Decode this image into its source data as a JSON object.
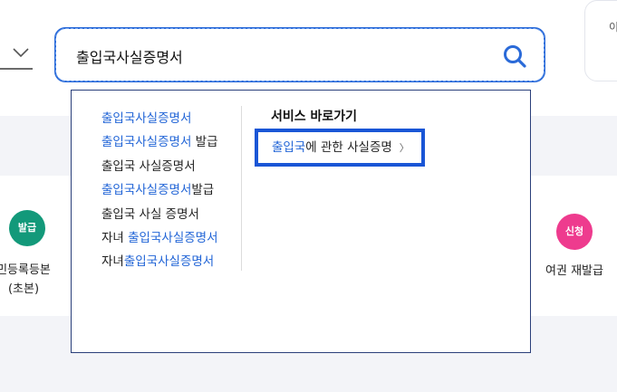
{
  "search": {
    "value": "출입국사실증명서",
    "suggestions": [
      [
        {
          "t": "출입국사실증명서",
          "hl": true
        }
      ],
      [
        {
          "t": "출입국사실증명서",
          "hl": true
        },
        {
          "t": " 발급",
          "hl": false
        }
      ],
      [
        {
          "t": "출입국 사실증명서",
          "hl": false
        }
      ],
      [
        {
          "t": "출입국사실증명서",
          "hl": true
        },
        {
          "t": "발급",
          "hl": false
        }
      ],
      [
        {
          "t": "출입국 사실 증명서",
          "hl": false
        }
      ],
      [
        {
          "t": "자녀 ",
          "hl": false
        },
        {
          "t": "출입국사실증명서",
          "hl": true
        }
      ],
      [
        {
          "t": "자녀",
          "hl": false
        },
        {
          "t": "출입국사실증명서",
          "hl": true
        }
      ]
    ]
  },
  "shortcut": {
    "title": "서비스 바로가기",
    "link_highlight": "출입국",
    "link_rest": "에 관한 사실증명",
    "arrow": "〉"
  },
  "services": {
    "left_badge": "발급",
    "left_label_line1": "민등록등본",
    "left_label_line2": "(초본)",
    "right_badge": "신청",
    "right_label": "여권 재발급"
  },
  "top_right_card_text": "이",
  "colors": {
    "accent": "#2a6ad8",
    "highlight_text": "#1f63d6",
    "issue_badge": "#13997a",
    "apply_badge": "#ee3b8e"
  },
  "icons": {
    "search": "search-icon",
    "dropdown_toggle": "chevron-down-icon",
    "link_arrow": "chevron-right-icon"
  }
}
